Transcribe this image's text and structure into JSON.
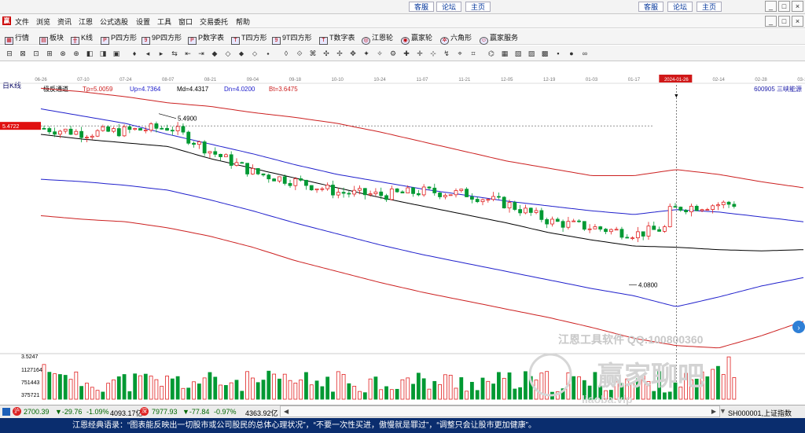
{
  "top_links": [
    "客服",
    "论坛",
    "主页"
  ],
  "window_buttons": [
    "_",
    "□",
    "×"
  ],
  "menu": [
    "文件",
    "浏览",
    "资讯",
    "江恩",
    "公式选股",
    "设置",
    "工具",
    "窗口",
    "交易委托",
    "帮助"
  ],
  "toolbar1": [
    "行情",
    "板块",
    "K线",
    "P四方形",
    "9P四方形",
    "P数字表",
    "T四方形",
    "9T四方形",
    "T数字表",
    "江恩轮",
    "赢家轮",
    "六角形",
    "赢家服务"
  ],
  "period_label": "日K线",
  "dates": [
    "06-26",
    "07-10",
    "07-24",
    "08-07",
    "08-21",
    "09-04",
    "09-18",
    "10-10",
    "10-24",
    "11-07",
    "11-21",
    "12-05",
    "12-19",
    "01-03",
    "01-17",
    "2024-01-26",
    "02-14",
    "02-28",
    "03-13"
  ],
  "indicator": {
    "name": "极反通道",
    "tp": "Tp=5.0059",
    "up": "Up=4.7364",
    "md": "Md=4.4317",
    "dn": "Dn=4.0200",
    "bt": "Bt=3.6475"
  },
  "stock_label": "600905 三峡能源",
  "price_left_label": "5.4722",
  "high_label": "5.4900",
  "low_label": "4.0800",
  "volume_axis": [
    "3.5247",
    "1127164",
    "751443",
    "375721"
  ],
  "watermark": {
    "line1": "江恩工具软件  QQ:100800360",
    "line2": "赢家聊吧",
    "line3": "liaoba.vip"
  },
  "status": {
    "idx1": "2700.39",
    "idx1_chg": "▼-29.76",
    "idx1_pct": "-1.09%",
    "idx1_amt": "4093.17亿",
    "idx2": "7977.93",
    "idx2_chg": "▼-77.84",
    "idx2_pct": "-0.97%",
    "idx2_amt": "4363.92亿",
    "right": "SH000001,上证指数"
  },
  "quote": "江恩经典语录：“图表能反映出一切股市或公司股民的总体心理状况”，“不要一次性买进，傲慢就是罪过”，“调整只会让股市更加健康”。",
  "colors": {
    "up": "#e02020",
    "down": "#009933",
    "channel_outer": "#cc2020",
    "channel_inner": "#2020cc",
    "mid": "#000000",
    "banner": "#0a2d6e"
  },
  "chart_data": {
    "type": "candlestick",
    "dates": [
      "06-26",
      "07-10",
      "07-24",
      "08-07",
      "08-21",
      "09-04",
      "09-18",
      "10-10",
      "10-24",
      "11-07",
      "11-21",
      "12-05",
      "12-19",
      "01-03",
      "01-17",
      "2024-01-26",
      "02-14",
      "02-28",
      "03-13"
    ],
    "channel": {
      "Tp": [
        5.7,
        5.67,
        5.63,
        5.58,
        5.55,
        5.5,
        5.46,
        5.41,
        5.34,
        5.26,
        5.18,
        5.1,
        5.04,
        4.98,
        4.98,
        5.03,
        4.99,
        4.93,
        4.88
      ],
      "Up": [
        5.53,
        5.47,
        5.41,
        5.32,
        5.24,
        5.16,
        5.07,
        4.99,
        4.93,
        4.87,
        4.82,
        4.77,
        4.73,
        4.69,
        4.66,
        4.7,
        4.68,
        4.64,
        4.6
      ],
      "Md": [
        5.32,
        5.28,
        5.25,
        5.22,
        5.12,
        5.04,
        4.96,
        4.88,
        4.8,
        4.73,
        4.66,
        4.59,
        4.51,
        4.45,
        4.4,
        4.39,
        4.37,
        4.36,
        4.37
      ],
      "Dn": [
        4.95,
        4.93,
        4.9,
        4.86,
        4.78,
        4.69,
        4.59,
        4.5,
        4.41,
        4.33,
        4.26,
        4.19,
        4.12,
        4.05,
        3.99,
        3.9,
        3.98,
        4.07,
        4.14
      ],
      "Bt": [
        4.65,
        4.62,
        4.6,
        4.55,
        4.48,
        4.39,
        4.28,
        4.19,
        4.1,
        4.02,
        3.95,
        3.88,
        3.81,
        3.73,
        3.64,
        3.58,
        3.56,
        3.66,
        3.78
      ]
    },
    "close": [
      5.37,
      5.33,
      5.35,
      5.38,
      5.17,
      5.0,
      4.93,
      4.84,
      4.82,
      4.85,
      4.83,
      4.74,
      4.6,
      4.55,
      4.5,
      4.57,
      4.52,
      4.45,
      4.4
    ],
    "high_marker": 5.49,
    "low_marker": 4.08,
    "ylim": [
      3.52,
      5.65
    ]
  }
}
